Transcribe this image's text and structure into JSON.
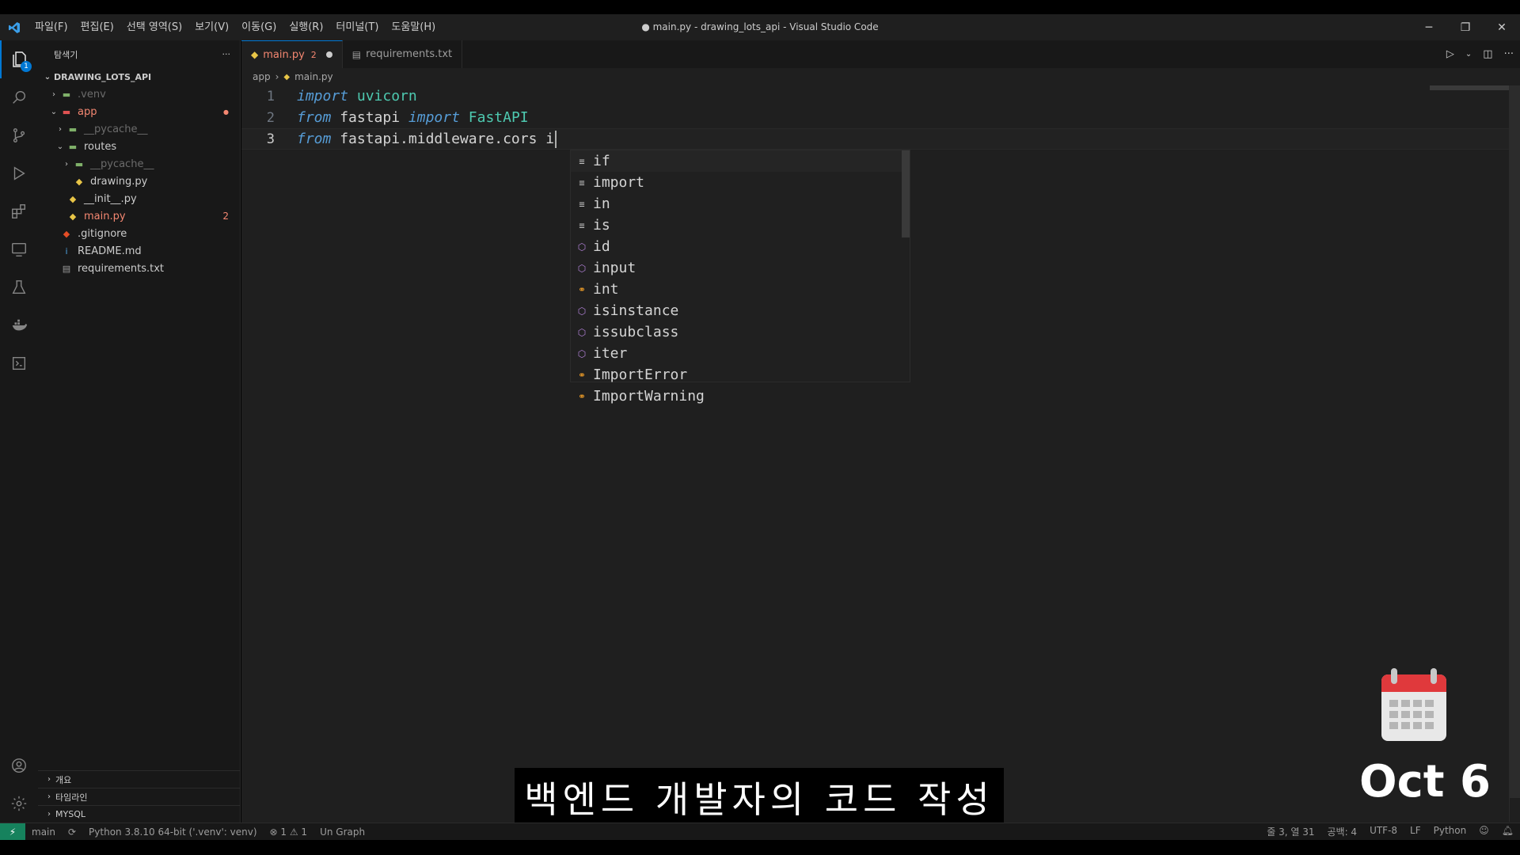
{
  "window": {
    "title": "● main.py - drawing_lots_api - Visual Studio Code"
  },
  "menu": [
    "파일(F)",
    "편집(E)",
    "선택 영역(S)",
    "보기(V)",
    "이동(G)",
    "실행(R)",
    "터미널(T)",
    "도움말(H)"
  ],
  "activity": {
    "explorer_badge": "1"
  },
  "sidebar": {
    "header": "탐색기",
    "more": "···",
    "section": "DRAWING_LOTS_API",
    "items": [
      {
        "label": ".venv",
        "indent": 1,
        "chevron": "›",
        "type": "folder",
        "dim": true
      },
      {
        "label": "app",
        "indent": 1,
        "chevron": "⌄",
        "type": "folder",
        "err": true
      },
      {
        "label": "__pycache__",
        "indent": 2,
        "chevron": "›",
        "type": "folder",
        "dim": true
      },
      {
        "label": "routes",
        "indent": 2,
        "chevron": "⌄",
        "type": "folder"
      },
      {
        "label": "__pycache__",
        "indent": 3,
        "chevron": "›",
        "type": "folder",
        "dim": true
      },
      {
        "label": "drawing.py",
        "indent": 3,
        "chevron": "",
        "type": "py"
      },
      {
        "label": "__init__.py",
        "indent": 2,
        "chevron": "",
        "type": "py"
      },
      {
        "label": "main.py",
        "indent": 2,
        "chevron": "",
        "type": "py",
        "err": true,
        "badge": "2"
      },
      {
        "label": ".gitignore",
        "indent": 1,
        "chevron": "",
        "type": "git"
      },
      {
        "label": "README.md",
        "indent": 1,
        "chevron": "",
        "type": "info"
      },
      {
        "label": "requirements.txt",
        "indent": 1,
        "chevron": "",
        "type": "txt"
      }
    ],
    "panels": [
      "개요",
      "타임라인",
      "MYSQL"
    ]
  },
  "tabs": [
    {
      "label": "main.py",
      "badge": "2",
      "active": true,
      "dirty": true
    },
    {
      "label": "requirements.txt",
      "active": false
    }
  ],
  "breadcrumb": [
    "app",
    "main.py"
  ],
  "code": {
    "lines": [
      {
        "n": "1",
        "tokens": [
          {
            "t": "import",
            "c": "kw"
          },
          {
            "t": " "
          },
          {
            "t": "uvicorn",
            "c": "cls"
          }
        ]
      },
      {
        "n": "2",
        "tokens": [
          {
            "t": "from",
            "c": "kw"
          },
          {
            "t": " fastapi ",
            "c": "ident"
          },
          {
            "t": "import",
            "c": "kw"
          },
          {
            "t": " "
          },
          {
            "t": "FastAPI",
            "c": "cls"
          }
        ]
      },
      {
        "n": "3",
        "tokens": [
          {
            "t": "from",
            "c": "kw"
          },
          {
            "t": " fastapi.middleware.cors i",
            "c": "ident"
          }
        ],
        "current": true
      }
    ]
  },
  "suggestions": [
    {
      "label": "if",
      "kind": "keyword"
    },
    {
      "label": "import",
      "kind": "keyword"
    },
    {
      "label": "in",
      "kind": "keyword"
    },
    {
      "label": "is",
      "kind": "keyword"
    },
    {
      "label": "id",
      "kind": "function"
    },
    {
      "label": "input",
      "kind": "function"
    },
    {
      "label": "int",
      "kind": "class"
    },
    {
      "label": "isinstance",
      "kind": "function"
    },
    {
      "label": "issubclass",
      "kind": "function"
    },
    {
      "label": "iter",
      "kind": "function"
    },
    {
      "label": "ImportError",
      "kind": "class"
    },
    {
      "label": "ImportWarning",
      "kind": "class"
    }
  ],
  "overlay": {
    "subtitle": "백엔드 개발자의 코드 작성",
    "date": "Oct 6"
  },
  "statusbar": {
    "branch": "main",
    "interpreter": "Python 3.8.10 64-bit ('.venv': venv)",
    "problems": "⊗ 1 ⚠ 1",
    "extra": "Un Graph",
    "position": "줄 3, 열 31",
    "spaces": "공백: 4",
    "encoding": "UTF-8",
    "eol": "LF",
    "language": "Python"
  }
}
